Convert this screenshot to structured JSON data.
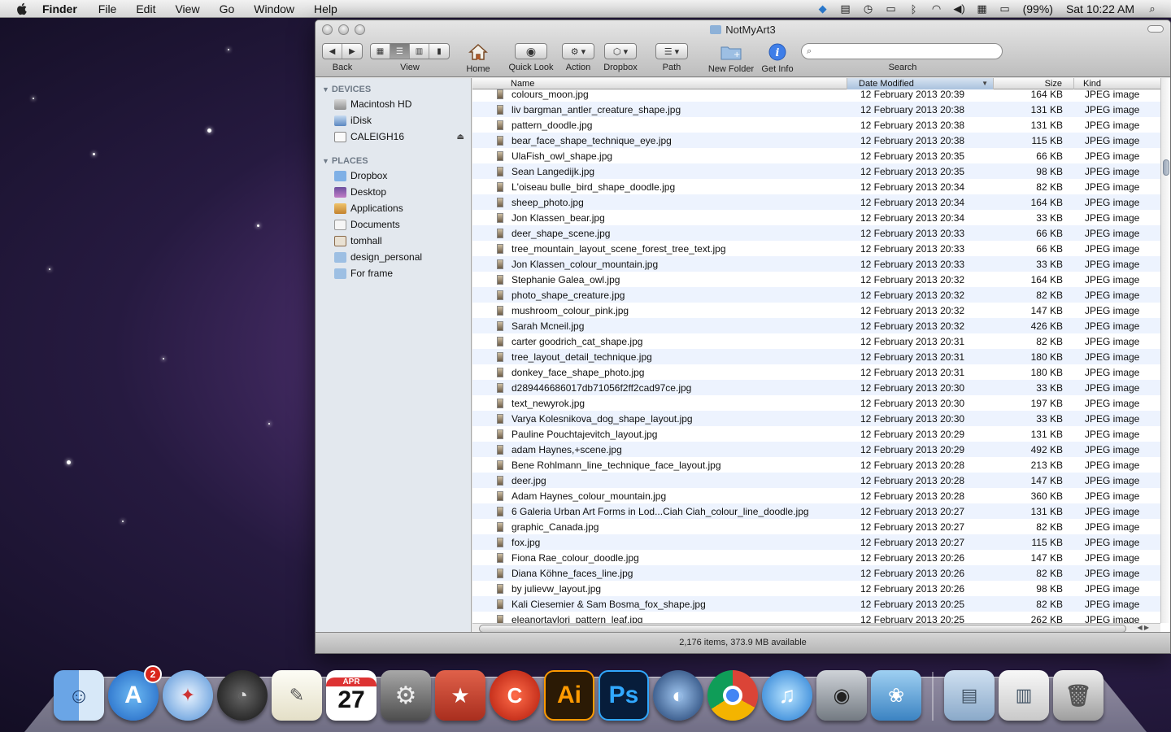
{
  "menubar": {
    "app": "Finder",
    "items": [
      "File",
      "Edit",
      "View",
      "Go",
      "Window",
      "Help"
    ],
    "battery": "(99%)",
    "clock": "Sat 10:22 AM"
  },
  "window": {
    "title": "NotMyArt3",
    "toolbar": {
      "back": "Back",
      "view": "View",
      "home": "Home",
      "quicklook": "Quick Look",
      "action": "Action",
      "dropbox": "Dropbox",
      "path": "Path",
      "newfolder": "New Folder",
      "getinfo": "Get Info",
      "search": "Search"
    },
    "status": "2,176 items, 373.9 MB available"
  },
  "sidebar": {
    "devices_header": "DEVICES",
    "devices": [
      "Macintosh HD",
      "iDisk",
      "CALEIGH16"
    ],
    "places_header": "PLACES",
    "places": [
      "Dropbox",
      "Desktop",
      "Applications",
      "Documents",
      "tomhall",
      "design_personal",
      "For frame"
    ]
  },
  "columns": {
    "name": "Name",
    "date": "Date Modified",
    "size": "Size",
    "kind": "Kind"
  },
  "files": [
    {
      "name": "colours_moon.jpg",
      "date": "12 February 2013 20:39",
      "size": "164 KB",
      "kind": "JPEG image"
    },
    {
      "name": "liv bargman_antler_creature_shape.jpg",
      "date": "12 February 2013 20:38",
      "size": "131 KB",
      "kind": "JPEG image"
    },
    {
      "name": "pattern_doodle.jpg",
      "date": "12 February 2013 20:38",
      "size": "131 KB",
      "kind": "JPEG image"
    },
    {
      "name": "bear_face_shape_technique_eye.jpg",
      "date": "12 February 2013 20:38",
      "size": "115 KB",
      "kind": "JPEG image"
    },
    {
      "name": "UlaFish_owl_shape.jpg",
      "date": "12 February 2013 20:35",
      "size": "66 KB",
      "kind": "JPEG image"
    },
    {
      "name": "Sean Langedijk.jpg",
      "date": "12 February 2013 20:35",
      "size": "98 KB",
      "kind": "JPEG image"
    },
    {
      "name": "L'oiseau bulle_bird_shape_doodle.jpg",
      "date": "12 February 2013 20:34",
      "size": "82 KB",
      "kind": "JPEG image"
    },
    {
      "name": "sheep_photo.jpg",
      "date": "12 February 2013 20:34",
      "size": "164 KB",
      "kind": "JPEG image"
    },
    {
      "name": "Jon Klassen_bear.jpg",
      "date": "12 February 2013 20:34",
      "size": "33 KB",
      "kind": "JPEG image"
    },
    {
      "name": "deer_shape_scene.jpg",
      "date": "12 February 2013 20:33",
      "size": "66 KB",
      "kind": "JPEG image"
    },
    {
      "name": "tree_mountain_layout_scene_forest_tree_text.jpg",
      "date": "12 February 2013 20:33",
      "size": "66 KB",
      "kind": "JPEG image"
    },
    {
      "name": "Jon Klassen_colour_mountain.jpg",
      "date": "12 February 2013 20:33",
      "size": "33 KB",
      "kind": "JPEG image"
    },
    {
      "name": "Stephanie Galea_owl.jpg",
      "date": "12 February 2013 20:32",
      "size": "164 KB",
      "kind": "JPEG image"
    },
    {
      "name": "photo_shape_creature.jpg",
      "date": "12 February 2013 20:32",
      "size": "82 KB",
      "kind": "JPEG image"
    },
    {
      "name": "mushroom_colour_pink.jpg",
      "date": "12 February 2013 20:32",
      "size": "147 KB",
      "kind": "JPEG image"
    },
    {
      "name": "Sarah Mcneil.jpg",
      "date": "12 February 2013 20:32",
      "size": "426 KB",
      "kind": "JPEG image"
    },
    {
      "name": "carter goodrich_cat_shape.jpg",
      "date": "12 February 2013 20:31",
      "size": "82 KB",
      "kind": "JPEG image"
    },
    {
      "name": "tree_layout_detail_technique.jpg",
      "date": "12 February 2013 20:31",
      "size": "180 KB",
      "kind": "JPEG image"
    },
    {
      "name": "donkey_face_shape_photo.jpg",
      "date": "12 February 2013 20:31",
      "size": "180 KB",
      "kind": "JPEG image"
    },
    {
      "name": "d289446686017db71056f2ff2cad97ce.jpg",
      "date": "12 February 2013 20:30",
      "size": "33 KB",
      "kind": "JPEG image"
    },
    {
      "name": "text_newyrok.jpg",
      "date": "12 February 2013 20:30",
      "size": "197 KB",
      "kind": "JPEG image"
    },
    {
      "name": "Varya Kolesnikova_dog_shape_layout.jpg",
      "date": "12 February 2013 20:30",
      "size": "33 KB",
      "kind": "JPEG image"
    },
    {
      "name": "Pauline Pouchtajevitch_layout.jpg",
      "date": "12 February 2013 20:29",
      "size": "131 KB",
      "kind": "JPEG image"
    },
    {
      "name": "adam Haynes,+scene.jpg",
      "date": "12 February 2013 20:29",
      "size": "492 KB",
      "kind": "JPEG image"
    },
    {
      "name": "Bene Rohlmann_line_technique_face_layout.jpg",
      "date": "12 February 2013 20:28",
      "size": "213 KB",
      "kind": "JPEG image"
    },
    {
      "name": "deer.jpg",
      "date": "12 February 2013 20:28",
      "size": "147 KB",
      "kind": "JPEG image"
    },
    {
      "name": "Adam Haynes_colour_mountain.jpg",
      "date": "12 February 2013 20:28",
      "size": "360 KB",
      "kind": "JPEG image"
    },
    {
      "name": "6 Galeria Urban Art Forms in Lod...Ciah Ciah_colour_line_doodle.jpg",
      "date": "12 February 2013 20:27",
      "size": "131 KB",
      "kind": "JPEG image"
    },
    {
      "name": "graphic_Canada.jpg",
      "date": "12 February 2013 20:27",
      "size": "82 KB",
      "kind": "JPEG image"
    },
    {
      "name": "fox.jpg",
      "date": "12 February 2013 20:27",
      "size": "115 KB",
      "kind": "JPEG image"
    },
    {
      "name": "Fiona Rae_colour_doodle.jpg",
      "date": "12 February 2013 20:26",
      "size": "147 KB",
      "kind": "JPEG image"
    },
    {
      "name": "Diana Köhne_faces_line.jpg",
      "date": "12 February 2013 20:26",
      "size": "82 KB",
      "kind": "JPEG image"
    },
    {
      "name": "by julievw_layout.jpg",
      "date": "12 February 2013 20:26",
      "size": "98 KB",
      "kind": "JPEG image"
    },
    {
      "name": "Kali Ciesemier & Sam Bosma_fox_shape.jpg",
      "date": "12 February 2013 20:25",
      "size": "82 KB",
      "kind": "JPEG image"
    },
    {
      "name": "eleanortaylori_pattern_leaf.jpg",
      "date": "12 February 2013 20:25",
      "size": "262 KB",
      "kind": "JPEG image"
    }
  ],
  "dock": {
    "calendar_month": "APR",
    "calendar_day": "27",
    "appstore_badge": "2",
    "illustrator": "Ai",
    "photoshop": "Ps"
  }
}
